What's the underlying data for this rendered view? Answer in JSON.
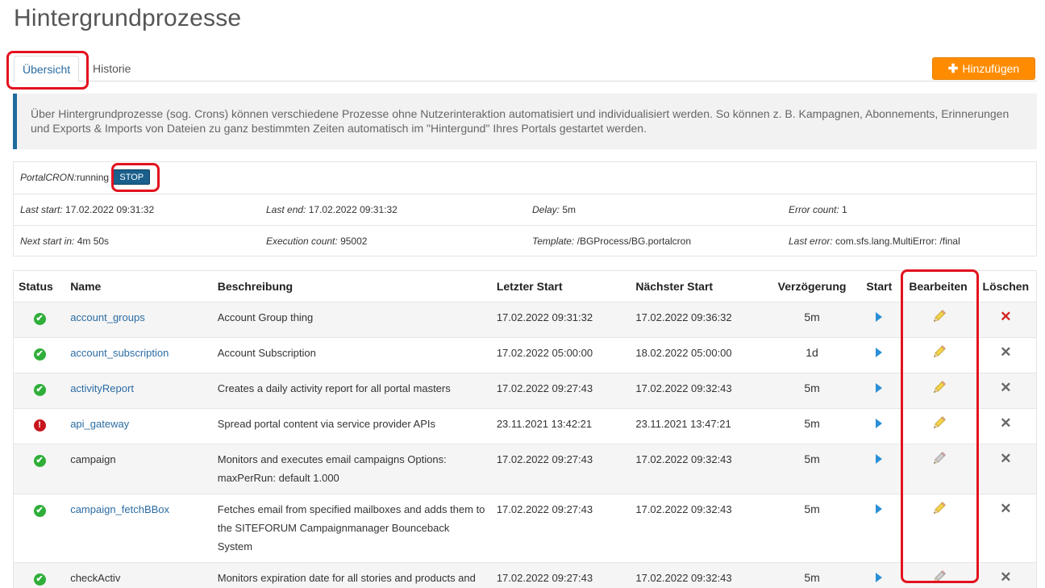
{
  "page": {
    "title": "Hintergrundprozesse"
  },
  "tabs": [
    {
      "label": "Übersicht",
      "active": true
    },
    {
      "label": "Historie",
      "active": false
    }
  ],
  "add_button": {
    "label": "Hinzufügen"
  },
  "info_text": "Über Hintergrundprozesse (sog. Crons) können verschiedene Prozesse ohne Nutzerinteraktion automatisiert und individualisiert werden. So können z. B. Kampagnen, Abonnements, Erinnerungen und Exports & Imports von Dateien zu ganz bestimmten Zeiten automatisch im \"Hintergund\" Ihres Portals gestartet werden.",
  "cron": {
    "status_label": "PortalCRON:",
    "status_value": "running",
    "stop_label": "STOP",
    "last_start": {
      "label": "Last start:",
      "value": "17.02.2022 09:31:32"
    },
    "last_end": {
      "label": "Last end:",
      "value": "17.02.2022 09:31:32"
    },
    "delay": {
      "label": "Delay:",
      "value": "5m"
    },
    "error_count": {
      "label": "Error count:",
      "value": "1"
    },
    "next_start": {
      "label": "Next start in:",
      "value": "4m 50s"
    },
    "execution_count": {
      "label": "Execution count:",
      "value": "95002"
    },
    "template": {
      "label": "Template:",
      "value": "/BGProcess/BG.portalcron"
    },
    "last_error": {
      "label": "Last error:",
      "value": "com.sfs.lang.MultiError: /final"
    }
  },
  "table": {
    "headers": {
      "status": "Status",
      "name": "Name",
      "description": "Beschreibung",
      "last_start": "Letzter Start",
      "next_start": "Nächster Start",
      "delay": "Verzögerung",
      "start": "Start",
      "edit": "Bearbeiten",
      "delete": "Löschen"
    },
    "rows": [
      {
        "status": "ok",
        "name": "account_groups",
        "linked": true,
        "description": "Account Group thing",
        "last_start": "17.02.2022 09:31:32",
        "next_start": "17.02.2022 09:36:32",
        "delay": "5m",
        "edit_icon": "pencil-yellow-icon",
        "delete_icon": "delete-red-icon"
      },
      {
        "status": "ok",
        "name": "account_subscription",
        "linked": true,
        "description": "Account Subscription",
        "last_start": "17.02.2022 05:00:00",
        "next_start": "18.02.2022 05:00:00",
        "delay": "1d",
        "edit_icon": "pencil-yellow-icon",
        "delete_icon": "delete-grey-icon"
      },
      {
        "status": "ok",
        "name": "activityReport",
        "linked": true,
        "description": "Creates a daily activity report for all portal masters",
        "last_start": "17.02.2022 09:27:43",
        "next_start": "17.02.2022 09:32:43",
        "delay": "5m",
        "edit_icon": "pencil-yellow-icon",
        "delete_icon": "delete-grey-icon"
      },
      {
        "status": "error",
        "name": "api_gateway",
        "linked": true,
        "description": "Spread portal content via service provider APIs",
        "last_start": "23.11.2021 13:42:21",
        "next_start": "23.11.2021 13:47:21",
        "delay": "5m",
        "edit_icon": "pencil-yellow-icon",
        "delete_icon": "delete-grey-icon"
      },
      {
        "status": "ok",
        "name": "campaign",
        "linked": false,
        "description": "Monitors and executes email campaigns Options: maxPerRun: default 1.000",
        "last_start": "17.02.2022 09:27:43",
        "next_start": "17.02.2022 09:32:43",
        "delay": "5m",
        "edit_icon": "pencil-grey-icon",
        "delete_icon": "delete-grey-icon"
      },
      {
        "status": "ok",
        "name": "campaign_fetchBBox",
        "linked": true,
        "description": "Fetches email from specified mailboxes and adds them to the SITEFORUM Campaignmanager Bounceback System",
        "last_start": "17.02.2022 09:27:43",
        "next_start": "17.02.2022 09:32:43",
        "delay": "5m",
        "edit_icon": "pencil-yellow-icon",
        "delete_icon": "delete-grey-icon"
      },
      {
        "status": "ok",
        "name": "checkActiv",
        "linked": false,
        "description": "Monitors expiration date for all stories and products and archives them if neccessary",
        "last_start": "17.02.2022 09:27:43",
        "next_start": "17.02.2022 09:32:43",
        "delay": "5m",
        "edit_icon": "pencil-grey-icon",
        "delete_icon": "delete-grey-icon"
      }
    ]
  },
  "colors": {
    "accent_blue": "#2b6ca3",
    "add_orange": "#ff8c00",
    "stop_blue": "#1b5f8c",
    "status_ok": "#2fae39",
    "status_error": "#c8151c",
    "annotation_red": "#e3121e"
  }
}
